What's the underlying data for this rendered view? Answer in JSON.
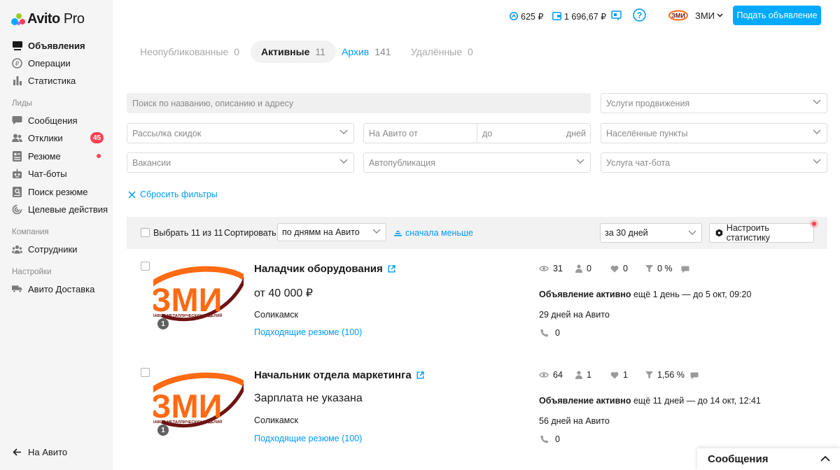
{
  "app": {
    "logo_main": "Avito",
    "logo_sub": "Pro"
  },
  "sidebar": {
    "items": [
      {
        "label": "Объявления",
        "icon": "listings-icon",
        "active": true
      },
      {
        "label": "Операции",
        "icon": "operations-icon"
      },
      {
        "label": "Статистика",
        "icon": "bar-chart-icon"
      }
    ],
    "section_leads": "Лиды",
    "leads_items": [
      {
        "label": "Сообщения",
        "icon": "chat-icon"
      },
      {
        "label": "Отклики",
        "icon": "responses-icon",
        "badge": "45"
      },
      {
        "label": "Резюме",
        "icon": "resume-icon",
        "dot": true
      },
      {
        "label": "Чат-боты",
        "icon": "robot-icon"
      },
      {
        "label": "Поиск резюме",
        "icon": "resume-search-icon"
      },
      {
        "label": "Целевые действия",
        "icon": "target-actions-icon"
      }
    ],
    "section_company": "Компания",
    "company_items": [
      {
        "label": "Сотрудники",
        "icon": "team-icon"
      }
    ],
    "section_settings": "Настройки",
    "settings_items": [
      {
        "label": "Авито Доставка",
        "icon": "truck-icon"
      }
    ],
    "footer_link": "На Авито"
  },
  "header": {
    "bonus": "625 ₽",
    "wallet": "1 696,67 ₽",
    "company_name": "ЗМИ",
    "post_button": "Подать объявление"
  },
  "tabs": [
    {
      "label": "Неопубликованные",
      "count": "0"
    },
    {
      "label": "Активные",
      "count": "11",
      "active": true
    },
    {
      "label": "Архив",
      "count": "141"
    },
    {
      "label": "Удалённые",
      "count": "0"
    }
  ],
  "filters": {
    "search_placeholder": "Поиск по названию, описанию и адресу",
    "promo": "Услуги продвижения",
    "discount": "Рассылка скидок",
    "days_from": "На Авито от",
    "days_to": "до",
    "days_unit": "дней",
    "locations": "Населённые пункты",
    "vacancies": "Вакансии",
    "autopublish": "Автопубликация",
    "chatbot_service": "Услуга чат-бота",
    "reset": "Сбросить фильтры"
  },
  "toolbar": {
    "select_label": "Выбрать 11 из 11",
    "sort_label": "Сортировать",
    "sort_value": "по днямм на Авито",
    "sort_dir": "сначала меньше",
    "period": "за 30 дней",
    "stat_button": "Настроить статистику"
  },
  "listings": [
    {
      "title": "Наладчик оборудования",
      "price": "от 40 000 ₽",
      "city": "Соликамск",
      "resumes_link": "Подходящие резюме (100)",
      "photos": "1",
      "views": "31",
      "contacts": "0",
      "favorites": "0",
      "conversion": "0 %",
      "status_bold": "Объявление активно",
      "status_rest": " ещё 1 день — до 5 окт, 09:20",
      "days": "29 дней на Авито",
      "calls": "0"
    },
    {
      "title": "Начальник отдела маркетинга",
      "price": "Зарплата не указана",
      "city": "Соликамск",
      "resumes_link": "Подходящие резюме (100)",
      "photos": "1",
      "views": "64",
      "contacts": "1",
      "favorites": "1",
      "conversion": "1,56 %",
      "status_bold": "Объявление активно",
      "status_rest": " ещё 11 дней — до 14 окт, 12:41",
      "days": "56 дней на Авито",
      "calls": "0"
    }
  ],
  "logo_thumb": {
    "letters": "ЗМИ",
    "tagline": "ЗАВОД МЕТАЛЛИЧЕСКИХ ИЗДЕЛИЙ"
  },
  "messages_widget": "Сообщения",
  "colors": {
    "accent": "#0099f7",
    "primary_button": "#00aaff",
    "badge": "#ff4053",
    "brand_orange": "#ff6a13",
    "brand_maroon": "#6e1313"
  }
}
